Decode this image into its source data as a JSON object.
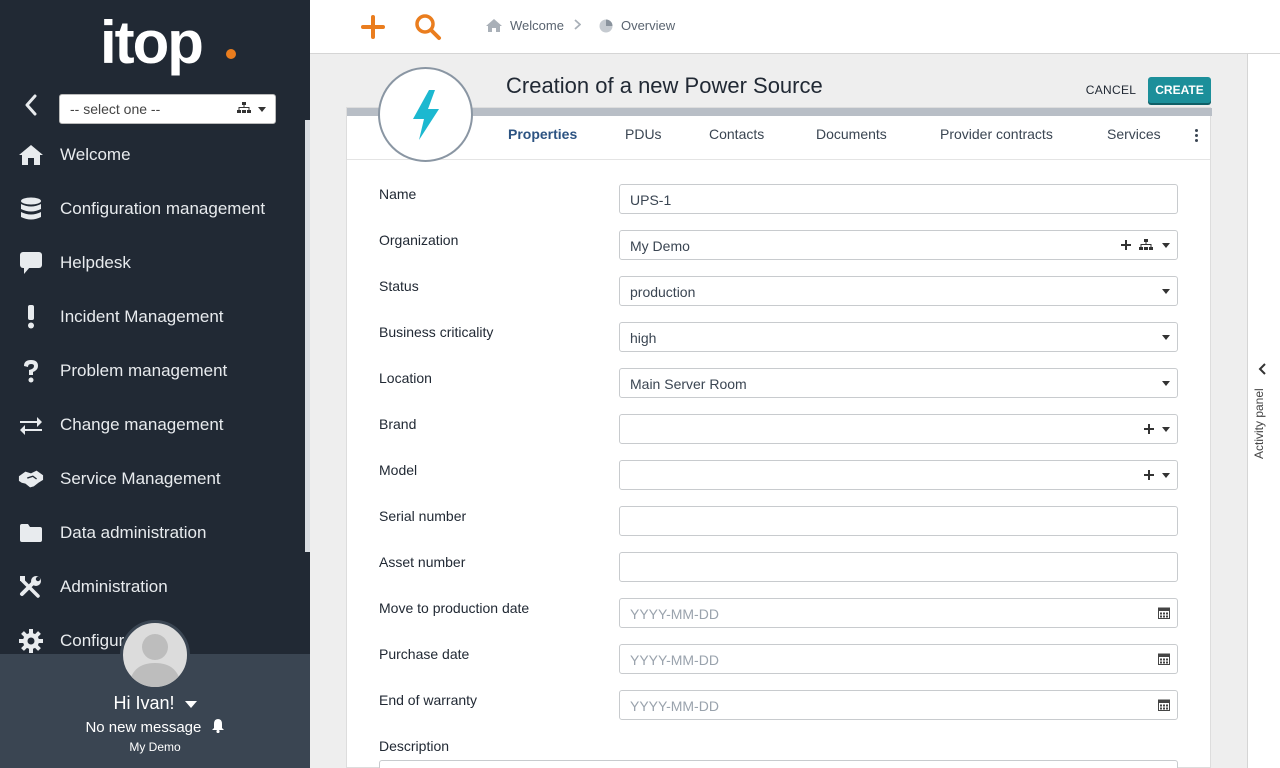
{
  "sidebar": {
    "logo": "itop",
    "org_select": "-- select one --",
    "items": [
      {
        "label": "Welcome",
        "icon": "home-icon"
      },
      {
        "label": "Configuration management",
        "icon": "database-icon"
      },
      {
        "label": "Helpdesk",
        "icon": "comment-icon"
      },
      {
        "label": "Incident Management",
        "icon": "exclamation-icon"
      },
      {
        "label": "Problem management",
        "icon": "question-icon"
      },
      {
        "label": "Change management",
        "icon": "exchange-icon"
      },
      {
        "label": "Service Management",
        "icon": "handshake-icon"
      },
      {
        "label": "Data administration",
        "icon": "folder-icon"
      },
      {
        "label": "Administration",
        "icon": "tools-icon"
      },
      {
        "label": "Configur",
        "icon": "gear-icon"
      }
    ],
    "user": {
      "greeting": "Hi Ivan!",
      "messages": "No new message",
      "org": "My Demo"
    }
  },
  "topbar": {
    "breadcrumb": [
      {
        "label": "Welcome",
        "icon": "home-icon"
      },
      {
        "label": "Overview",
        "icon": "pie-chart-icon"
      }
    ]
  },
  "form": {
    "title": "Creation of a new Power Source",
    "cancel_label": "CANCEL",
    "create_label": "CREATE",
    "tabs": [
      "Properties",
      "PDUs",
      "Contacts",
      "Documents",
      "Provider contracts",
      "Services"
    ],
    "active_tab": "Properties",
    "fields": {
      "name": {
        "label": "Name",
        "value": "UPS-1"
      },
      "organization": {
        "label": "Organization",
        "value": "My Demo"
      },
      "status": {
        "label": "Status",
        "value": "production"
      },
      "business_criticality": {
        "label": "Business criticality",
        "value": "high"
      },
      "location": {
        "label": "Location",
        "value": "Main Server Room"
      },
      "brand": {
        "label": "Brand",
        "value": ""
      },
      "model": {
        "label": "Model",
        "value": ""
      },
      "serial_number": {
        "label": "Serial number",
        "value": ""
      },
      "asset_number": {
        "label": "Asset number",
        "value": ""
      },
      "move_to_production_date": {
        "label": "Move to production date",
        "placeholder": "YYYY-MM-DD"
      },
      "purchase_date": {
        "label": "Purchase date",
        "placeholder": "YYYY-MM-DD"
      },
      "end_of_warranty": {
        "label": "End of warranty",
        "placeholder": "YYYY-MM-DD"
      },
      "description": {
        "label": "Description",
        "value": ""
      }
    }
  },
  "activity_panel": {
    "label": "Activity panel"
  },
  "colors": {
    "sidebar_bg": "#212934",
    "user_panel_bg": "#3a4552",
    "brand_orange": "#ea7d1e",
    "create_button": "#1c8f9a",
    "power_icon": "#1cb8d0",
    "active_tab": "#2c5382"
  }
}
